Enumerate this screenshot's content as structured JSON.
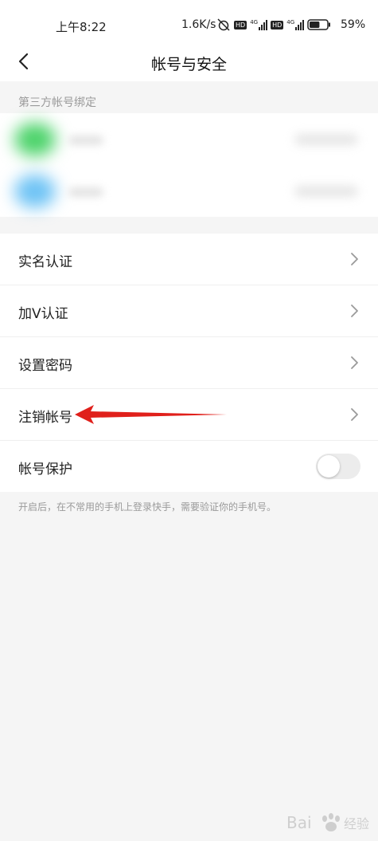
{
  "status_bar": {
    "time": "上午8:22",
    "network_speed": "1.6K/s",
    "hd1": "HD",
    "sig1": "4G",
    "hd2": "HD",
    "sig2": "4G",
    "battery_percent": "59%",
    "battery_level": 0.59
  },
  "nav": {
    "title": "帐号与安全",
    "back_icon": "chevron-left-icon"
  },
  "third_party": {
    "section_label": "第三方帐号绑定",
    "accounts": [
      {
        "icon_color": "#4cd36a"
      },
      {
        "icon_color": "#6ec3f5"
      }
    ]
  },
  "menu": {
    "items": [
      {
        "label": "实名认证"
      },
      {
        "label": "加V认证"
      },
      {
        "label": "设置密码"
      },
      {
        "label": "注销帐号"
      },
      {
        "label": "帐号保护"
      }
    ],
    "protection_enabled": false
  },
  "footnote": "开启后，在不常用的手机上登录快手，需要验证你的手机号。",
  "colors": {
    "annotation_arrow": "#e0201b",
    "page_background": "#f5f5f5"
  }
}
